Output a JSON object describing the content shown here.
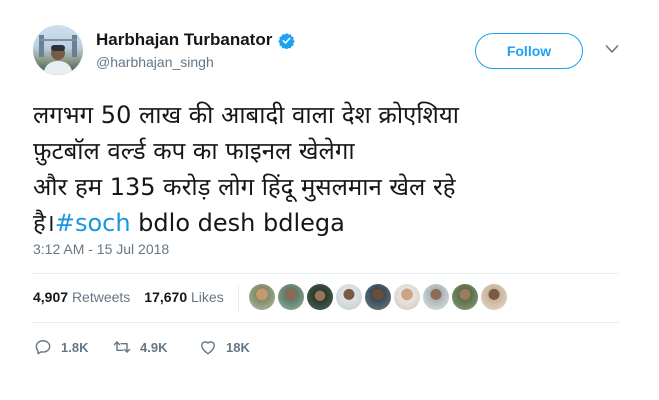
{
  "author": {
    "name": "Harbhajan Turbanator",
    "handle": "@harbhajan_singh",
    "verified_icon": "verified-badge-icon"
  },
  "follow_button": {
    "label": "Follow"
  },
  "tweet": {
    "line1": "लगभग 50 लाख की आबादी वाला देश क्रोएशिया",
    "line2": "फ़ुटबॉल वर्ल्ड कप का फाइनल खेलेगा",
    "line3": "और हम 135 करोड़ लोग हिंदू मुसलमान खेल रहे",
    "line4_prefix": "है।",
    "hashtag": "#soch",
    "line4_suffix": " bdlo desh bdlega"
  },
  "timestamp": "3:12 AM - 15 Jul 2018",
  "stats": {
    "retweets_count": "4,907",
    "retweets_label": "Retweets",
    "likes_count": "17,670",
    "likes_label": "Likes"
  },
  "actions": {
    "replies": "1.8K",
    "retweets": "4.9K",
    "likes": "18K"
  },
  "colors": {
    "accent": "#1da1f2",
    "hashtag": "#1b95e0",
    "muted": "#657786",
    "divider": "#e6ecf0"
  }
}
